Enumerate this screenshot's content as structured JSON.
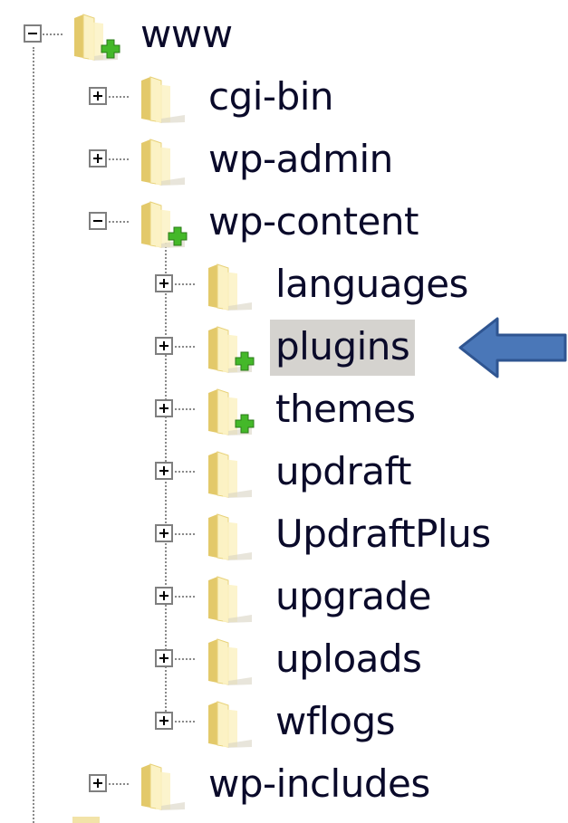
{
  "tree": {
    "root": {
      "label": "www",
      "expanded": true,
      "has_overlay": true
    },
    "children": [
      {
        "label": "cgi-bin",
        "expanded": false,
        "has_overlay": false
      },
      {
        "label": "wp-admin",
        "expanded": false,
        "has_overlay": false
      },
      {
        "label": "wp-content",
        "expanded": true,
        "has_overlay": true,
        "children": [
          {
            "label": "languages",
            "has_overlay": false
          },
          {
            "label": "plugins",
            "has_overlay": true,
            "selected": true
          },
          {
            "label": "themes",
            "has_overlay": true
          },
          {
            "label": "updraft",
            "has_overlay": false
          },
          {
            "label": "UpdraftPlus",
            "has_overlay": false
          },
          {
            "label": "upgrade",
            "has_overlay": false
          },
          {
            "label": "uploads",
            "has_overlay": false
          },
          {
            "label": "wflogs",
            "has_overlay": false
          }
        ]
      },
      {
        "label": "wp-includes",
        "expanded": false,
        "has_overlay": false
      }
    ]
  },
  "colors": {
    "selection": "#d5d3cf",
    "arrow_fill": "#4a77b8",
    "arrow_stroke": "#2f5591",
    "overlay_green": "#44b829",
    "folder_light": "#fbf2c4",
    "folder_dark": "#e3c96a"
  },
  "icons": {
    "expand": "plus-box",
    "collapse": "minus-box",
    "folder": "folder-icon",
    "overlay": "green-plus-overlay",
    "pointer": "left-arrow"
  }
}
